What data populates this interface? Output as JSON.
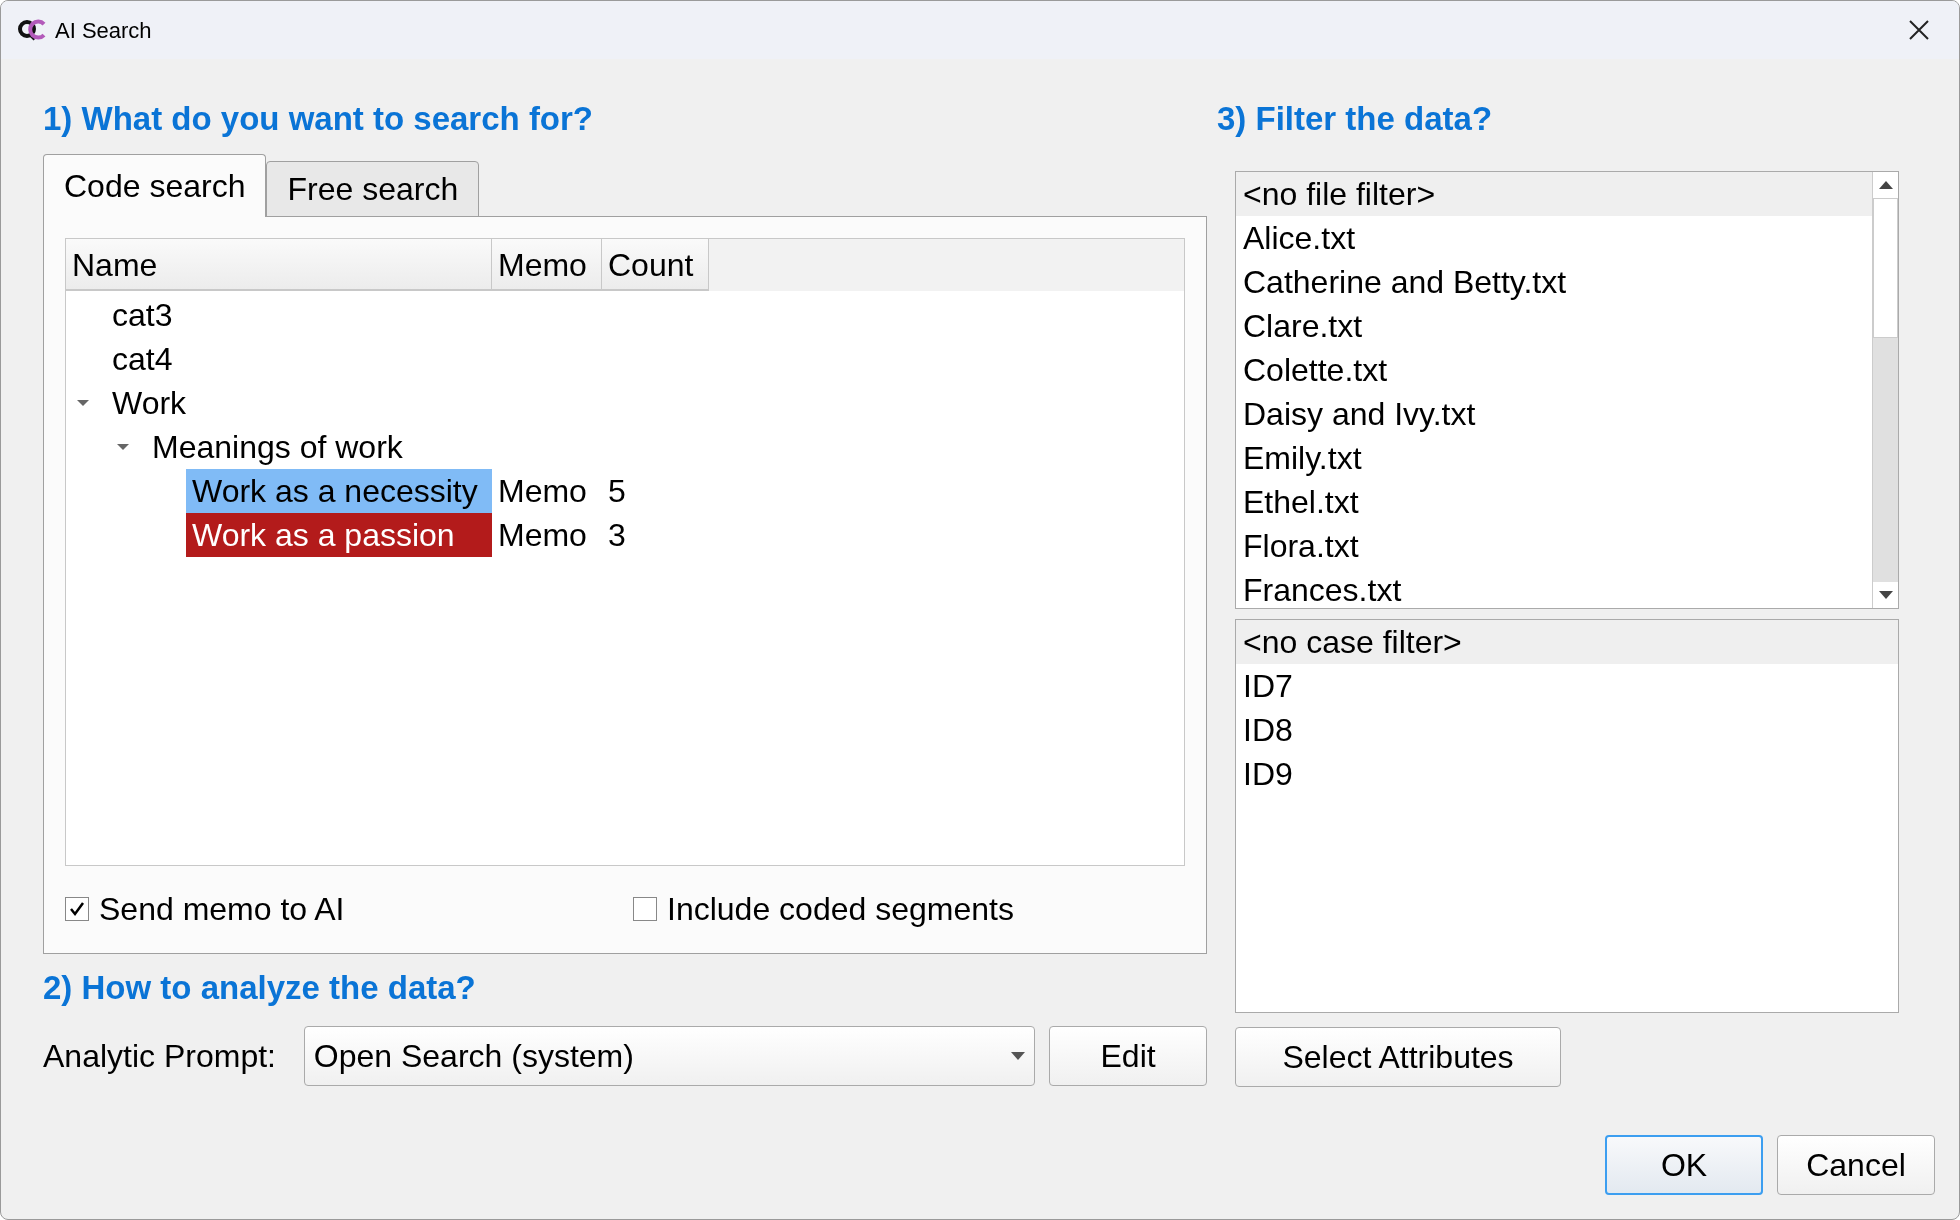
{
  "window": {
    "title": "AI Search"
  },
  "section_1": {
    "heading": "1) What do you want to search for?",
    "tabs": [
      {
        "label": "Code search",
        "selected": true
      },
      {
        "label": "Free search",
        "selected": false
      }
    ],
    "tree": {
      "columns": [
        "Name",
        "Memo",
        "Count"
      ],
      "items": [
        {
          "name": "cat3"
        },
        {
          "name": "cat4"
        },
        {
          "name": "Work",
          "expanded": true,
          "children": [
            {
              "name": "Meanings of work",
              "expanded": true,
              "children": [
                {
                  "name": "Work as a necessity",
                  "color": "#80bbf6",
                  "memo": "Memo",
                  "count": "5"
                },
                {
                  "name": "Work as a passion",
                  "color": "#b31b1b",
                  "memo": "Memo",
                  "count": "3"
                }
              ]
            }
          ]
        }
      ]
    },
    "options": [
      {
        "label": "Send memo to AI",
        "checked": true
      },
      {
        "label": "Include coded segments",
        "checked": false
      }
    ]
  },
  "section_2": {
    "heading": "2) How to analyze the data?",
    "prompt_label": "Analytic Prompt:",
    "prompt_value": "Open Search (system)",
    "edit_button": "Edit"
  },
  "section_3": {
    "heading": "3) Filter the data?",
    "file_filter": [
      {
        "label": "<no file filter>",
        "selected": true
      },
      {
        "label": "Alice.txt",
        "selected": false
      },
      {
        "label": "Catherine and Betty.txt",
        "selected": false
      },
      {
        "label": "Clare.txt",
        "selected": false
      },
      {
        "label": "Colette.txt",
        "selected": false
      },
      {
        "label": "Daisy and Ivy.txt",
        "selected": false
      },
      {
        "label": "Emily.txt",
        "selected": false
      },
      {
        "label": "Ethel.txt",
        "selected": false
      },
      {
        "label": "Flora.txt",
        "selected": false
      },
      {
        "label": "Frances.txt",
        "selected": false
      }
    ],
    "case_filter": [
      {
        "label": "<no case filter>",
        "selected": true
      },
      {
        "label": "ID7",
        "selected": false
      },
      {
        "label": "ID8",
        "selected": false
      },
      {
        "label": "ID9",
        "selected": false
      }
    ],
    "attributes_button": "Select Attributes"
  },
  "buttons": [
    {
      "label": "OK",
      "default": true
    },
    {
      "label": "Cancel",
      "default": false
    }
  ]
}
